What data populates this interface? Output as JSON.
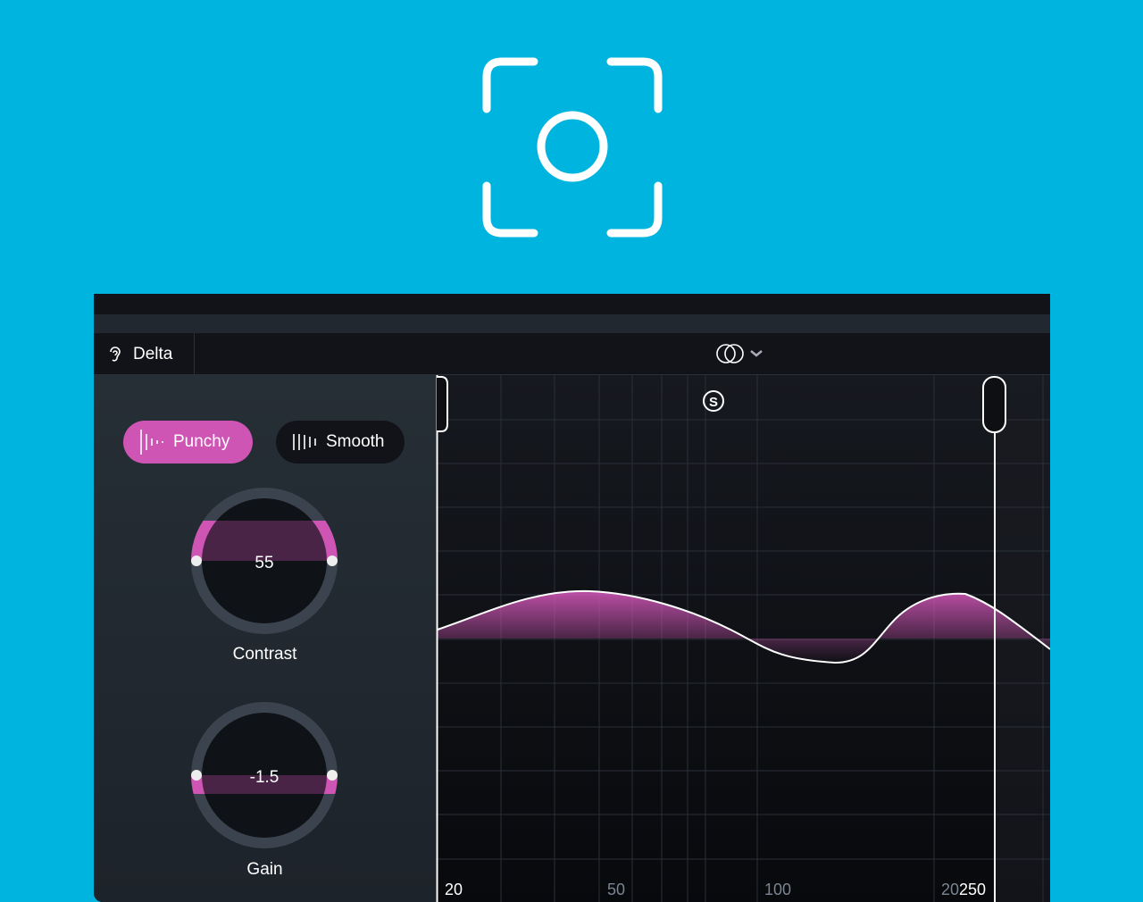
{
  "header": {
    "delta_label": "Delta",
    "icons": {
      "ear": "ear-icon",
      "link": "linked-circles-icon",
      "chevron": "chevron-down-icon",
      "solo": "solo-s-icon",
      "camera": "screenshot-camera-icon"
    }
  },
  "modes": [
    {
      "label": "Punchy",
      "active": true
    },
    {
      "label": "Smooth",
      "active": false
    }
  ],
  "knobs": {
    "contrast": {
      "label": "Contrast",
      "value": "55"
    },
    "gain": {
      "label": "Gain",
      "value": "-1.5"
    }
  },
  "freq_labels": {
    "f20": "20",
    "f50": "50",
    "f100": "100",
    "f200": "20",
    "f250": "250"
  },
  "colors": {
    "accent": "#cf55b5",
    "background": "#00b4e0"
  }
}
